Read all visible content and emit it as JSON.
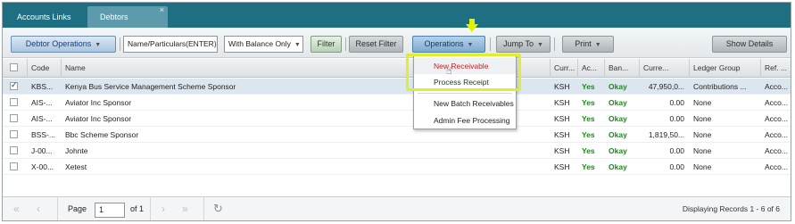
{
  "tabs": [
    {
      "label": "Accounts Links"
    },
    {
      "label": "Debtors",
      "close": "×"
    }
  ],
  "toolbar": {
    "debtor_ops": "Debtor Operations",
    "search_placeholder": "Name/Particulars(ENTER)",
    "balance_filter": "With Balance Only",
    "filter": "Filter",
    "reset": "Reset Filter",
    "operations": "Operations",
    "jump_to": "Jump To",
    "print": "Print",
    "show_details": "Show Details"
  },
  "menu": {
    "items": [
      {
        "label": "New Receivable"
      },
      {
        "label": "Process Receipt"
      },
      {
        "label": "New Batch Receivables"
      },
      {
        "label": "Admin Fee Processing"
      }
    ]
  },
  "grid": {
    "columns": [
      "Code",
      "Name",
      "Curr...",
      "Ac...",
      "Ban...",
      "Curre...",
      "Ledger Group",
      "Ref. ..."
    ],
    "rows": [
      {
        "checked": true,
        "code": "KBS...",
        "name": "Kenya Bus Service Management Scheme Sponsor",
        "curr": "KSH",
        "active": "Yes",
        "bank": "Okay",
        "current": "47,950,0...",
        "ledger": "Contributions ...",
        "ref": "Acco..."
      },
      {
        "checked": false,
        "code": "AIS-...",
        "name": "Aviator Inc Sponsor",
        "curr": "KSH",
        "active": "Yes",
        "bank": "Okay",
        "current": "0.00",
        "ledger": "None",
        "ref": "Acco..."
      },
      {
        "checked": false,
        "code": "AIS-...",
        "name": "Aviator Inc Sponsor",
        "curr": "KSH",
        "active": "Yes",
        "bank": "Okay",
        "current": "0.00",
        "ledger": "None",
        "ref": "Acco..."
      },
      {
        "checked": false,
        "code": "BSS-...",
        "name": "Bbc Scheme Sponsor",
        "curr": "KSH",
        "active": "Yes",
        "bank": "Okay",
        "current": "1,819,50...",
        "ledger": "None",
        "ref": "Acco..."
      },
      {
        "checked": false,
        "code": "J-00...",
        "name": "Johnte",
        "curr": "KSH",
        "active": "Yes",
        "bank": "Okay",
        "current": "0.00",
        "ledger": "None",
        "ref": "Acco..."
      },
      {
        "checked": false,
        "code": "X-00...",
        "name": "Xetest",
        "curr": "KSH",
        "active": "Yes",
        "bank": "Okay",
        "current": "0.00",
        "ledger": "None",
        "ref": "Acco..."
      }
    ]
  },
  "pager": {
    "page_label": "Page",
    "page_value": "1",
    "of_label": "of 1",
    "status": "Displaying Records 1 - 6 of 6"
  },
  "colors": {
    "tab_bar": "#1f6f83",
    "active_tab": "#5d9aab",
    "highlight": "#dfee2d",
    "ok_green": "#1a8a1a",
    "menu_hot": "#d11a1a"
  }
}
